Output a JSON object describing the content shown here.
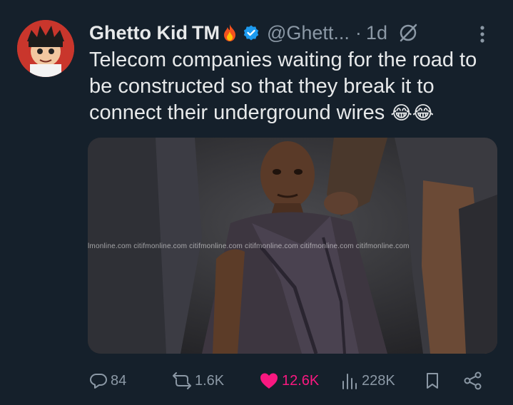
{
  "tweet": {
    "author_name": "Ghetto Kid",
    "trademark": "TM",
    "handle": "@Ghett...",
    "separator": "·",
    "time": "1d",
    "text_main": "Telecom companies waiting for the road to be constructed so that they break it to connect their underground wires",
    "text_emoji": "😂😂"
  },
  "media": {
    "watermark": "lmonline.com citifmonline.com citifmonline.com citifmonline.com citifmonline.com citifmonline.com"
  },
  "actions": {
    "replies": "84",
    "reposts": "1.6K",
    "likes": "12.6K",
    "views": "228K"
  },
  "colors": {
    "background": "#15202b",
    "text": "#e7e9ea",
    "secondary": "#8b98a5",
    "like": "#f91880",
    "verified": "#1d9bf0"
  },
  "icons": [
    "fire-icon",
    "verified-badge-icon",
    "grok-icon",
    "more-icon",
    "reply-icon",
    "repost-icon",
    "like-icon",
    "views-icon",
    "bookmark-icon",
    "share-icon"
  ]
}
